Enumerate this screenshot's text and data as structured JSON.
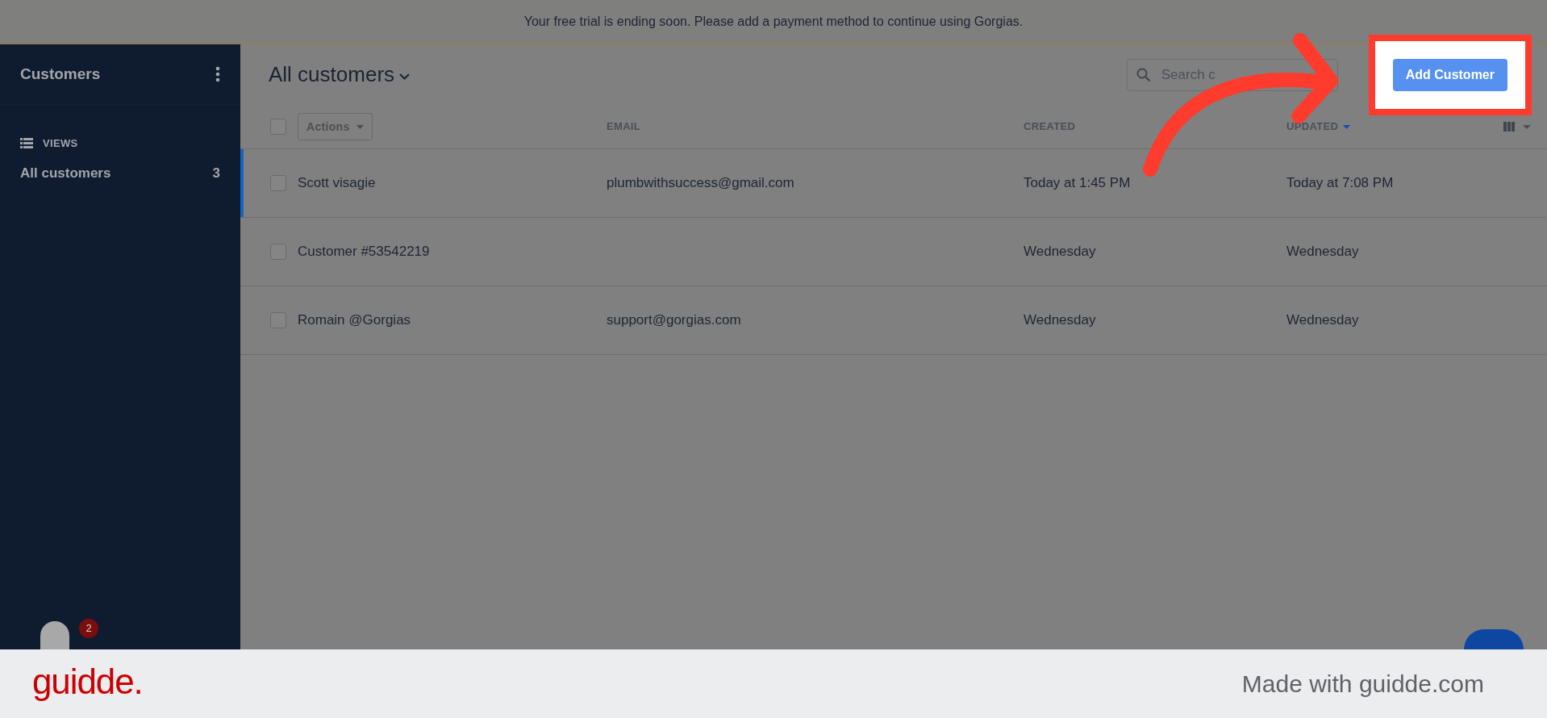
{
  "banner": {
    "text": "Your free trial is ending soon. Please add a payment method to continue using Gorgias."
  },
  "sidebar": {
    "title": "Customers",
    "section_label": "VIEWS",
    "items": [
      {
        "label": "All customers",
        "count": "3",
        "selected": true
      }
    ],
    "avatar": {
      "badge": "2"
    }
  },
  "header": {
    "title": "All customers",
    "search": {
      "placeholder": "Search c"
    },
    "add_button": "Add Customer",
    "highlighted": true
  },
  "table": {
    "all_checked": false,
    "actions_button": "Actions",
    "actions_disabled": true,
    "columns": [
      {
        "label": "EMAIL",
        "sorted": false
      },
      {
        "label": "CREATED",
        "sorted": false
      },
      {
        "label": "UPDATED",
        "sorted": true
      }
    ],
    "rows": [
      {
        "name": "Scott visagie",
        "email": "plumbwithsuccess@gmail.com",
        "created": "Today at 1:45 PM",
        "updated": "Today at 7:08 PM",
        "selected": true,
        "checked": false
      },
      {
        "name": "Customer #53542219",
        "created": "Wednesday",
        "updated": "Wednesday",
        "selected": false,
        "checked": false
      },
      {
        "name": "Romain @Gorgias",
        "email": "support@gorgias.com",
        "created": "Wednesday",
        "updated": "Wednesday",
        "selected": false,
        "checked": false
      }
    ]
  },
  "footer": {
    "brand": "guidde.",
    "credit": "Made with guidde.com"
  }
}
